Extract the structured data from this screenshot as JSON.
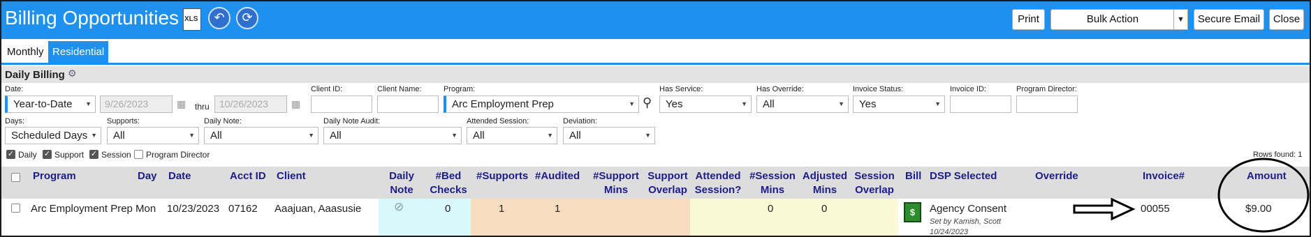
{
  "header": {
    "title": "Billing Opportunities",
    "xls_label": "XLS",
    "print_label": "Print",
    "bulk_action_label": "Bulk Action",
    "secure_email_label": "Secure Email",
    "close_label": "Close"
  },
  "tabs": [
    {
      "label": "Monthly",
      "active": false
    },
    {
      "label": "Residential",
      "active": true
    }
  ],
  "section": {
    "title": "Daily Billing"
  },
  "filters": {
    "date_label": "Date:",
    "date_value": "Year-to-Date",
    "date_from": "9/26/2023",
    "thru_label": "thru",
    "date_to": "10/26/2023",
    "client_id_label": "Client ID:",
    "client_name_label": "Client Name:",
    "program_label": "Program:",
    "program_value": "Arc Employment Prep",
    "has_service_label": "Has Service:",
    "has_service_value": "Yes",
    "has_override_label": "Has Override:",
    "has_override_value": "All",
    "invoice_status_label": "Invoice Status:",
    "invoice_status_value": "Yes",
    "invoice_id_label": "Invoice ID:",
    "program_director_label": "Program Director:",
    "days_label": "Days:",
    "days_value": "Scheduled Days",
    "supports_label": "Supports:",
    "supports_value": "All",
    "daily_note_label": "Daily Note:",
    "daily_note_value": "All",
    "daily_note_audit_label": "Daily Note Audit:",
    "daily_note_audit_value": "All",
    "attended_session_label": "Attended Session:",
    "attended_session_value": "All",
    "deviation_label": "Deviation:",
    "deviation_value": "All"
  },
  "checkboxes": [
    {
      "label": "Daily",
      "checked": true
    },
    {
      "label": "Support",
      "checked": true
    },
    {
      "label": "Session",
      "checked": true
    },
    {
      "label": "Program Director",
      "checked": false
    }
  ],
  "rows_found": "Rows found: 1",
  "table": {
    "headers": {
      "program": "Program",
      "day": "Day",
      "date": "Date",
      "acct_id": "Acct ID",
      "client": "Client",
      "daily_note_1": "Daily",
      "daily_note_2": "Note",
      "bed_checks_1": "#Bed",
      "bed_checks_2": "Checks",
      "supports": "#Supports",
      "audited": "#Audited",
      "support_mins_1": "#Support",
      "support_mins_2": "Mins",
      "support_overlap_1": "Support",
      "support_overlap_2": "Overlap",
      "attended_session_1": "Attended",
      "attended_session_2": "Session?",
      "session_mins_1": "#Session",
      "session_mins_2": "Mins",
      "adjusted_mins_1": "Adjusted",
      "adjusted_mins_2": "Mins",
      "session_overlap_1": "Session",
      "session_overlap_2": "Overlap",
      "bill": "Bill",
      "dsp_selected": "DSP Selected",
      "override": "Override",
      "invoice": "Invoice#",
      "amount": "Amount"
    },
    "rows": [
      {
        "program": "Arc Employment Prep",
        "day": "Mon",
        "date": "10/23/2023",
        "acct_id": "07162",
        "client": "Aaajuan, Aaasusie",
        "bed_checks": "0",
        "supports": "1",
        "audited": "1",
        "session_mins": "0",
        "adjusted_mins": "0",
        "dsp_selected": "Agency Consent",
        "set_by": "Set by Kamish, Scott",
        "set_date": "10/24/2023",
        "invoice": "00055",
        "amount": "$9.00"
      }
    ]
  },
  "colors": {
    "brand_blue": "#1e90f0",
    "header_text": "#1d1d8a",
    "note_cell": "#d8f8fb",
    "support_cells": "#f8dcc0",
    "session_cells": "#fbf8d6"
  }
}
